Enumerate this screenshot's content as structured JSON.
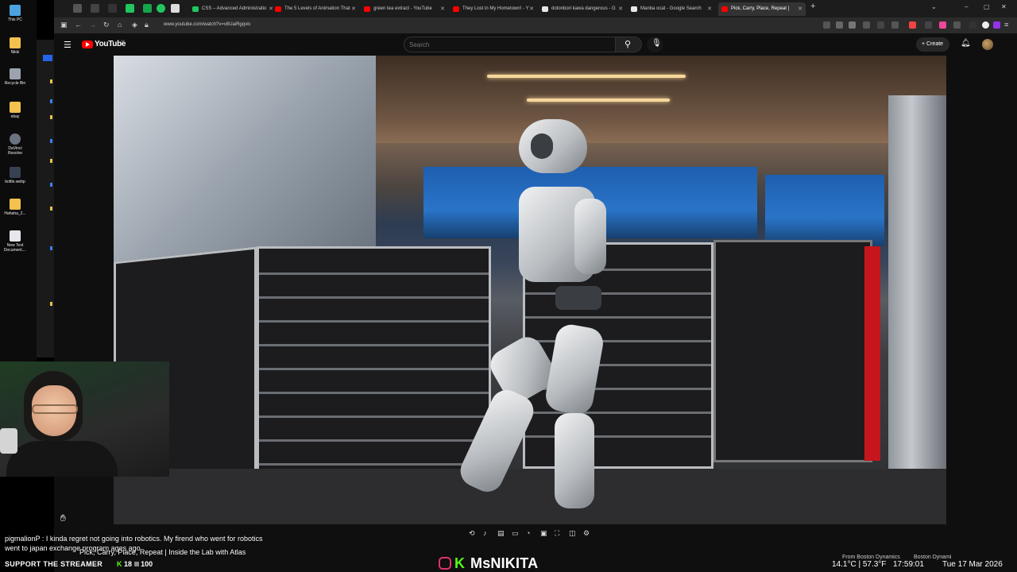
{
  "desktop": {
    "icons": [
      {
        "label": "This PC",
        "color": "#4aa3df"
      },
      {
        "label": "Nikki",
        "color": "#f2c14e"
      },
      {
        "label": "Recycle Bin",
        "color": "#9ca3af"
      },
      {
        "label": "ebay",
        "color": "#f2c14e"
      },
      {
        "label": "DaVinci Resolve",
        "color": "#6b7280"
      },
      {
        "label": "bottle.webp",
        "color": "#374151"
      },
      {
        "label": "Hahaha_2...",
        "color": "#f2c14e"
      },
      {
        "label": "New Text Document....",
        "color": "#e5e7eb"
      }
    ]
  },
  "browser": {
    "tabs": [
      {
        "label": "CSS – Advanced Administratio",
        "fav": "#22c55e"
      },
      {
        "label": "The 5 Levels of Animation That",
        "fav": "#ff0000"
      },
      {
        "label": "green tea extract - YouTube",
        "fav": "#ff0000"
      },
      {
        "label": "They Lost in My Hometown! - Y",
        "fav": "#ff0000"
      },
      {
        "label": "dotonbori kawa dangerous - G",
        "fav": "#e5e7eb"
      },
      {
        "label": "Manba ocat - Google Search",
        "fav": "#e5e7eb"
      },
      {
        "label": "Pick, Carry, Place, Repeat |",
        "fav": "#ff0000",
        "active": true
      }
    ],
    "url": "www.youtube.com/watch?v=v8UaiRgqvic",
    "new_tab": "+",
    "min": "–",
    "max": "▢",
    "close": "✕"
  },
  "youtube": {
    "logo_text": "YouTube",
    "region": "SE",
    "search_placeholder": "Search",
    "create_label": "Create"
  },
  "stream": {
    "chat_user": "pigmalionP",
    "chat_message": " : I kinda regret not going into robotics. My firend who went for robotics went to japan exchange program ages ago",
    "video_title": "Pick, Carry, Place, Repeat | Inside the Lab with Atlas",
    "support_text": "SUPPORT THE STREAMER",
    "support_count": "18",
    "support_goal": "100",
    "brand_name": "MsNIKITA",
    "brand_k": "K"
  },
  "taskbar": {
    "from1": "From Boston Dynamics",
    "from2": "Boston Dynami",
    "weather": "14.1°C | 57.3°F",
    "time": "17:59:01",
    "date": "Tue 17 Mar 2026"
  }
}
